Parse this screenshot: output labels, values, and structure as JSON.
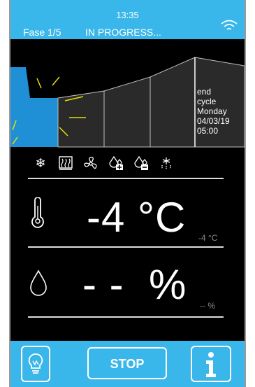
{
  "header": {
    "time": "13:35",
    "phase": "Fase 1/5",
    "status": "IN PROGRESS..."
  },
  "timeline": {
    "end_label_1": "end",
    "end_label_2": "cycle",
    "day": "Monday",
    "date": "04/03/19",
    "time": "05:00"
  },
  "icons": [
    "snowflake-icon",
    "heater-icon",
    "fan-icon",
    "humidity-plus-icon",
    "humidity-minus-icon",
    "defrost-icon"
  ],
  "temperature": {
    "value": "-4 °C",
    "setpoint": "-4 °C"
  },
  "humidity": {
    "value": "- -  %",
    "setpoint": "-- %"
  },
  "footer": {
    "stop_label": "STOP"
  },
  "colors": {
    "accent": "#39b6ea",
    "timeline_active": "#1f8fd6",
    "background": "#000000"
  }
}
